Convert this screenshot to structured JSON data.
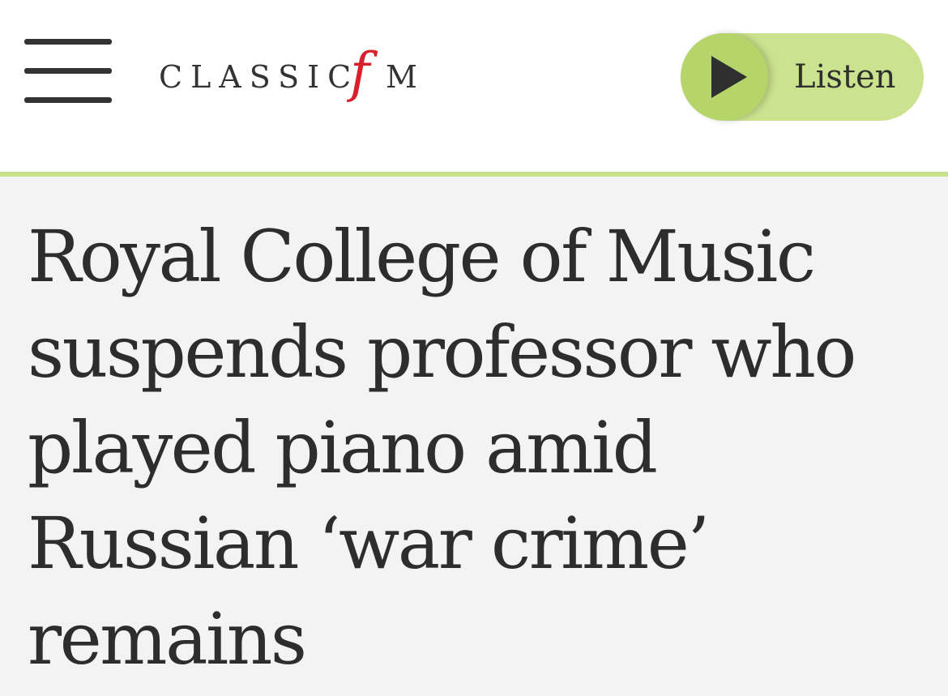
{
  "header": {
    "menu_icon": "hamburger-menu-icon",
    "logo": {
      "part1": "CLASSIC",
      "part2": "f",
      "part3": "M"
    },
    "listen_button": {
      "label": "Listen",
      "icon": "play-icon"
    }
  },
  "article": {
    "headline": "Royal College of Music suspends professor who played piano amid Russian ‘war crime’ remains"
  },
  "colors": {
    "accent_green": "#c8df8c",
    "play_circle": "#b5d56a",
    "logo_red": "#d8202a",
    "text_dark": "#2d2d2d",
    "article_bg": "#f3f3f3"
  }
}
